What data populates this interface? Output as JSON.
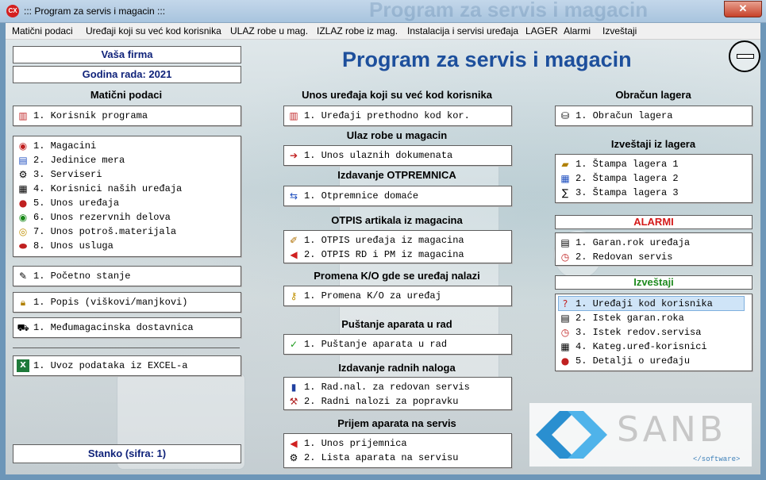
{
  "window": {
    "title": "::: Program za servis i magacin :::",
    "icon_text": "CX",
    "ghost_title": "Program za servis i magacin"
  },
  "menu": [
    "Matični podaci",
    "Uređaji koji su već kod korisnika",
    "ULAZ robe u mag.",
    "IZLAZ robe iz mag.",
    "Instalacija i servisi uređaja",
    "LAGER",
    "Alarmi",
    "Izveštaji"
  ],
  "header": {
    "company": "Vaša firma",
    "year": "Godina rada: 2021",
    "app_title": "Program za servis i magacin",
    "user": "Stanko (sifra: 1)"
  },
  "left": {
    "maticni_title": "Matični podaci",
    "korisnik": "1. Korisnik programa",
    "items": [
      "1. Magacini",
      "2. Jedinice mera",
      "3. Serviseri",
      "4. Korisnici naših uređaja",
      "5. Unos uređaja",
      "6. Unos rezervnih delova",
      "7. Unos potroš.materijala",
      "8. Unos usluga"
    ],
    "pocetno": "1. Početno stanje",
    "popis": "1. Popis (viškovi/manjkovi)",
    "medju": "1. Međumagacinska dostavnica",
    "excel": "1. Uvoz podataka iz EXCEL-a"
  },
  "middle": {
    "kod_kor_title": "Unos uređaja koji su već kod korisnika",
    "kod_kor": "1. Uređaji prethodno kod kor.",
    "ulaz_title": "Ulaz robe u magacin",
    "ulaz": "1. Unos ulaznih dokumenata",
    "otpremnica_title": "Izdavanje OTPREMNICA",
    "otpremnica": "1. Otpremnice domaće",
    "otpis_title": "OTPIS artikala iz magacina",
    "otpis": [
      "1. OTPIS uređaja iz magacina",
      "2. OTPIS RD i PM iz magacina"
    ],
    "promena_title": "Promena K/O gde se uređaj nalazi",
    "promena": "1. Promena K/O za uređaj",
    "pustanje_title": "Puštanje aparata u rad",
    "pustanje": "1. Puštanje aparata u rad",
    "nalozi_title": "Izdavanje radnih naloga",
    "nalozi": [
      "1. Rad.nal. za redovan servis",
      "2. Radni nalozi za popravku"
    ],
    "prijem_title": "Prijem aparata na servis",
    "prijem": [
      "1. Unos prijemnica",
      "2. Lista aparata na servisu"
    ]
  },
  "right": {
    "obracun_title": "Obračun lagera",
    "obracun": "1. Obračun lagera",
    "izvestaji_lager_title": "Izveštaji iz lagera",
    "izvestaji_lager": [
      "1. Štampa lagera 1",
      "2. Štampa lagera 2",
      "3. Štampa lagera 3"
    ],
    "alarmi_title": "ALARMI",
    "alarmi": [
      "1. Garan.rok uređaja",
      "2. Redovan servis"
    ],
    "izvestaji_title": "Izveštaji",
    "izvestaji": [
      "1. Uređaji kod korisnika",
      "2. Istek garan.roka",
      "3. Istek redov.servisa",
      "4. Kateg.uređ-korisnici",
      "5. Detalji o uređaju"
    ]
  },
  "logo": {
    "text": "SANB",
    "tagline": "</software>"
  },
  "colors": {
    "title_blue": "#1d4f9c",
    "alarm_red": "#d41a1a",
    "report_green": "#1e8a1e",
    "header_navy": "#10237a"
  }
}
